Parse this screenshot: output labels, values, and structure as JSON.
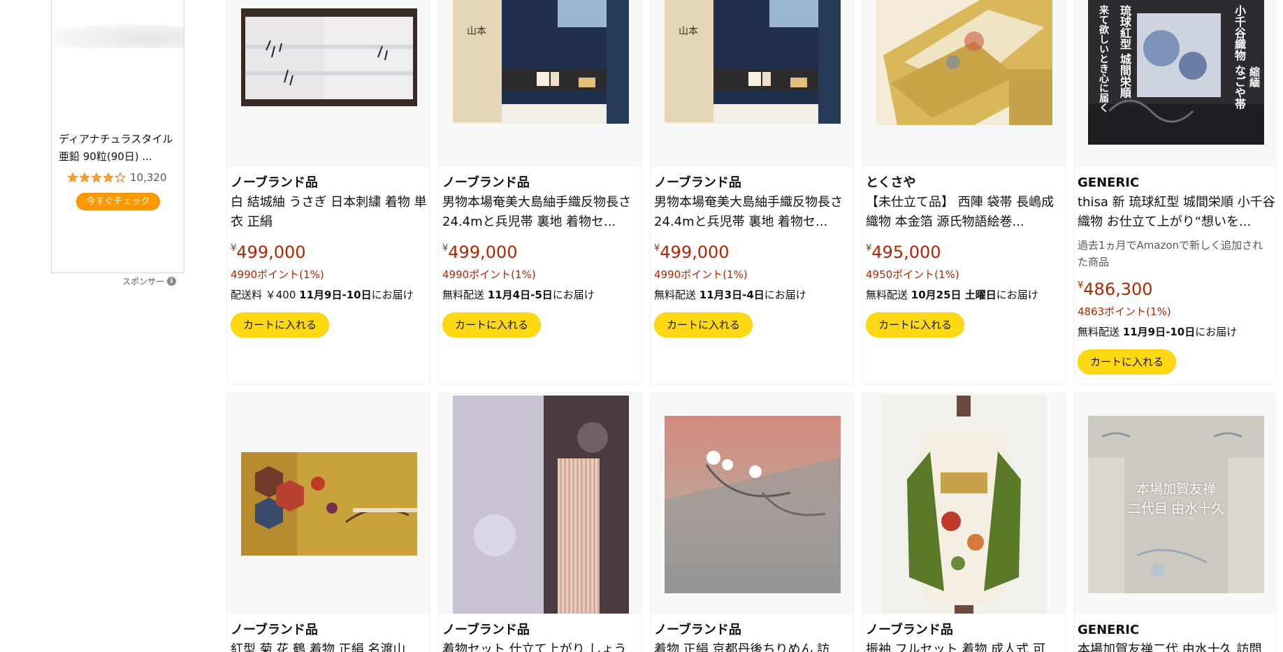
{
  "sponsored_ad": {
    "title": "ディアナチュラスタイル 亜鉛 90粒(90日) ...",
    "rating": 4.0,
    "rating_count": "10,320",
    "cta": "今すぐチェック",
    "sponsor_label": "スポンサー",
    "info_glyph": "i"
  },
  "products": [
    {
      "brand": "ノーブランド品",
      "title": "白 結城紬 うさぎ 日本刺繍 着物 単衣 正絹",
      "currency": "¥",
      "price": "499,000",
      "points": "4990ポイント(1%)",
      "delivery_prefix": "配送料 ￥400 ",
      "delivery_date": "11月9日-10日",
      "delivery_suffix": "にお届け",
      "cart_label": "カートに入れる",
      "image_icon": "kimono-white-fabric-image"
    },
    {
      "brand": "ノーブランド品",
      "title": "男物本場奄美大島紬手織反物長さ24.4mと兵児帯 裏地 着物セ...",
      "currency": "¥",
      "price": "499,000",
      "points": "4990ポイント(1%)",
      "delivery_prefix": "無料配送 ",
      "delivery_date": "11月4日-5日",
      "delivery_suffix": "にお届け",
      "cart_label": "カートに入れる",
      "image_icon": "oshima-tsumugi-set-image"
    },
    {
      "brand": "ノーブランド品",
      "title": "男物本場奄美大島紬手織反物長さ24.4mと兵児帯 裏地 着物セ...",
      "currency": "¥",
      "price": "499,000",
      "points": "4990ポイント(1%)",
      "delivery_prefix": "無料配送 ",
      "delivery_date": "11月3日-4日",
      "delivery_suffix": "にお届け",
      "cart_label": "カートに入れる",
      "image_icon": "oshima-tsumugi-set-image"
    },
    {
      "brand": "とくさや",
      "title": "【未仕立て品】 西陣 袋帯 長嶋成織物 本金箔 源氏物語絵巻...",
      "currency": "¥",
      "price": "495,000",
      "points": "4950ポイント(1%)",
      "delivery_prefix": "無料配送 ",
      "delivery_date": "10月25日 土曜日",
      "delivery_suffix": "にお届け",
      "cart_label": "カートに入れる",
      "image_icon": "gold-obi-image"
    },
    {
      "brand": "GENERIC",
      "title": "thisa 新 琉球紅型 城間栄順 小千谷織物 お仕立て上がり“想いを...",
      "note": "過去1ヵ月でAmazonで新しく追加された商品",
      "currency": "¥",
      "price": "486,300",
      "points": "4863ポイント(1%)",
      "delivery_prefix": "無料配送 ",
      "delivery_date": "11月9日-10日",
      "delivery_suffix": "にお届け",
      "cart_label": "カートに入れる",
      "image_icon": "bingata-nagoya-obi-image",
      "image_text": {
        "left_col": "琉球紅型 城間栄順",
        "left_col2": "来て欲しいとき心に届く",
        "right_col": "小千谷織物 なごや帯",
        "right_col2": "縮緬"
      }
    },
    {
      "brand": "ノーブランド品",
      "title": "紅型 菊 花 鶴 着物 正絹 名渡山",
      "image_icon": "yellow-bingata-kimono-image"
    },
    {
      "brand": "ノーブランド品",
      "title": "着物セット 仕立て上がり しょう",
      "image_icon": "purple-kimono-set-image"
    },
    {
      "brand": "ノーブランド品",
      "title": "着物 正絹 京都丹後ちりめん 訪",
      "image_icon": "pink-gray-kimono-image"
    },
    {
      "brand": "ノーブランド品",
      "title": "振袖 フルセット 着物 成人式 可",
      "image_icon": "furisode-mannequin-image"
    },
    {
      "brand": "GENERIC",
      "title": "本場加賀友禅二代 由水十久 訪問",
      "image_icon": "kaga-yuzen-kimono-image",
      "image_text": {
        "line1": "本場加賀友禅",
        "line2": "二代目 由水十久"
      }
    }
  ]
}
